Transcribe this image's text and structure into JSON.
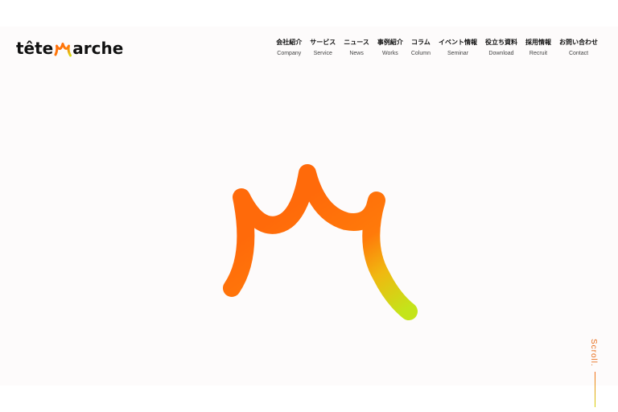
{
  "logo": {
    "text_before": "tête",
    "text_after": "arche",
    "mark_icon": "crown-m-icon"
  },
  "nav": [
    {
      "jp": "会社紹介",
      "en": "Company"
    },
    {
      "jp": "サービス",
      "en": "Service"
    },
    {
      "jp": "ニュース",
      "en": "News"
    },
    {
      "jp": "事例紹介",
      "en": "Works"
    },
    {
      "jp": "コラム",
      "en": "Column"
    },
    {
      "jp": "イベント情報",
      "en": "Seminar"
    },
    {
      "jp": "役立ち資料",
      "en": "Download"
    },
    {
      "jp": "採用情報",
      "en": "Recruit"
    },
    {
      "jp": "お問い合わせ",
      "en": "Contact"
    }
  ],
  "scroll": {
    "label": "Scroll."
  },
  "colors": {
    "brand_orange": "#ff6a0a",
    "brand_lime": "#c7e31a",
    "text": "#111111",
    "background": "#fdfbfb"
  }
}
